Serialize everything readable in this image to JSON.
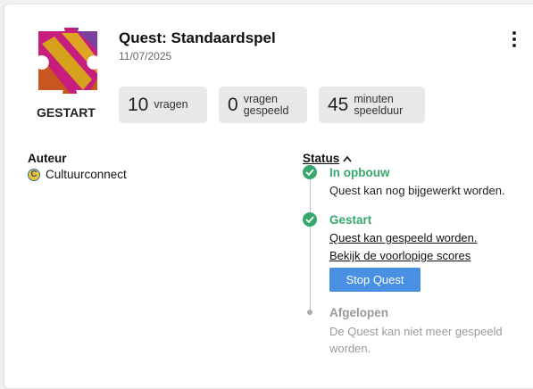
{
  "quest": {
    "title": "Quest: Standaardspel",
    "date": "11/07/2025",
    "state_label": "GESTART"
  },
  "stats": [
    {
      "number": "10",
      "label_line1": "vragen",
      "label_line2": ""
    },
    {
      "number": "0",
      "label_line1": "vragen",
      "label_line2": "gespeeld"
    },
    {
      "number": "45",
      "label_line1": "minuten",
      "label_line2": "speelduur"
    }
  ],
  "author": {
    "heading": "Auteur",
    "icon_letter": "C",
    "name": "Cultuurconnect"
  },
  "status": {
    "heading": "Status",
    "steps": [
      {
        "title": "In opbouw",
        "desc": "Quest kan nog bijgewerkt worden."
      },
      {
        "title": "Gestart",
        "link1": "Quest kan gespeeld worden.",
        "link2": "Bekijk de voorlopige scores",
        "button": "Stop Quest"
      },
      {
        "title": "Afgelopen",
        "desc": "De Quest kan niet meer gespeeld worden."
      }
    ]
  },
  "colors": {
    "accent_green": "#36a86e",
    "button_blue": "#4a90e2",
    "stat_bg": "#e8e8e8"
  },
  "icons": {
    "logo": "puzzle-piece-logo",
    "menu": "more-vertical-icon",
    "status_toggle": "chevron-up-icon",
    "done": "check-circle-icon",
    "pending": "dot-icon"
  }
}
